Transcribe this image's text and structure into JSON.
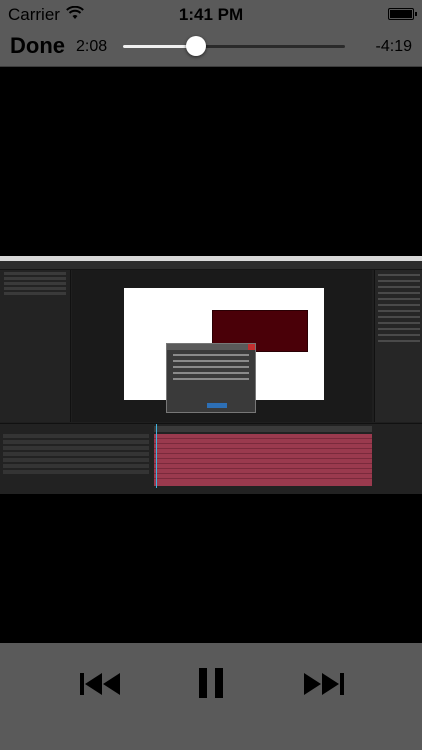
{
  "status_bar": {
    "carrier": "Carrier",
    "time": "1:41 PM"
  },
  "player": {
    "done_label": "Done",
    "elapsed": "2:08",
    "remaining": "-4:19",
    "progress_fraction": 0.33
  },
  "icons": {
    "wifi": "wifi-icon",
    "battery": "battery-icon",
    "previous": "skip-back-icon",
    "pause": "pause-icon",
    "next": "skip-forward-icon"
  },
  "colors": {
    "bar_background": "#5a5a5a",
    "video_background": "#000000",
    "solid_layer": "#4a0008",
    "timeline_tracks": "#9a3a4e"
  }
}
